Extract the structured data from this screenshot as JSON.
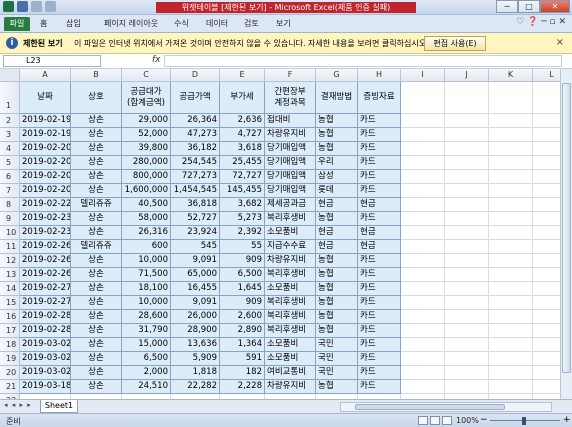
{
  "window": {
    "title": "위젯테이블 [제한된 보기] - Microsoft Excel(제품 인증 실패)",
    "min": "─",
    "max": "□",
    "close": "✕"
  },
  "ribbon": {
    "tabs": [
      "파일",
      "홈",
      "삽입",
      "페이지 레이아웃",
      "수식",
      "데이터",
      "검토",
      "보기"
    ],
    "right_icons": "♡ ❓ ─ ▫ ✕"
  },
  "protected_view": {
    "title": "제한된 보기",
    "message": "이 파일은 인터넷 위치에서 가져온 것이며 안전하지 않을 수 있습니다. 자세한 내용을 보려면 클릭하십시오.",
    "button": "편집 사용(E)",
    "close": "×"
  },
  "formula_bar": {
    "name_box": "L23",
    "fx": "fx",
    "value": ""
  },
  "columns": [
    "A",
    "B",
    "C",
    "D",
    "E",
    "F",
    "G",
    "H",
    "I",
    "J",
    "K",
    "L"
  ],
  "headers": [
    "날짜",
    "상호",
    "공급대가\n(합계금액)",
    "공급가액",
    "부가세",
    "간편장부\n계정과목",
    "결재방법",
    "증빙자료"
  ],
  "rows": [
    [
      "2019-02-19",
      "상손",
      "29,000",
      "26,364",
      "2,636",
      "접대비",
      "농협",
      "카드"
    ],
    [
      "2019-02-19",
      "상손",
      "52,000",
      "47,273",
      "4,727",
      "차량유지비",
      "농협",
      "카드"
    ],
    [
      "2019-02-20",
      "상손",
      "39,800",
      "36,182",
      "3,618",
      "당기매입액",
      "농협",
      "카드"
    ],
    [
      "2019-02-20",
      "상손",
      "280,000",
      "254,545",
      "25,455",
      "당기매입액",
      "우리",
      "카드"
    ],
    [
      "2019-02-20",
      "상손",
      "800,000",
      "727,273",
      "72,727",
      "당기매입액",
      "삼성",
      "카드"
    ],
    [
      "2019-02-20",
      "상손",
      "1,600,000",
      "1,454,545",
      "145,455",
      "당기매입액",
      "롯데",
      "카드"
    ],
    [
      "2019-02-22",
      "델리쥬쥬",
      "40,500",
      "36,818",
      "3,682",
      "제세공과금",
      "현금",
      "현금"
    ],
    [
      "2019-02-23",
      "상손",
      "58,000",
      "52,727",
      "5,273",
      "복리후생비",
      "농협",
      "카드"
    ],
    [
      "2019-02-23",
      "상손",
      "26,316",
      "23,924",
      "2,392",
      "소모품비",
      "현금",
      "현금"
    ],
    [
      "2019-02-26",
      "델리쥬쥬",
      "600",
      "545",
      "55",
      "지급수수료",
      "현금",
      "현금"
    ],
    [
      "2019-02-26",
      "상손",
      "10,000",
      "9,091",
      "909",
      "차량유지비",
      "농협",
      "카드"
    ],
    [
      "2019-02-26",
      "상손",
      "71,500",
      "65,000",
      "6,500",
      "복리후생비",
      "농협",
      "카드"
    ],
    [
      "2019-02-27",
      "상손",
      "18,100",
      "16,455",
      "1,645",
      "소모품비",
      "농협",
      "카드"
    ],
    [
      "2019-02-27",
      "상손",
      "10,000",
      "9,091",
      "909",
      "복리후생비",
      "농협",
      "카드"
    ],
    [
      "2019-02-28",
      "상손",
      "28,600",
      "26,000",
      "2,600",
      "복리후생비",
      "농협",
      "카드"
    ],
    [
      "2019-02-28",
      "상손",
      "31,790",
      "28,900",
      "2,890",
      "복리후생비",
      "농협",
      "카드"
    ],
    [
      "2019-03-02",
      "상손",
      "15,000",
      "13,636",
      "1,364",
      "소모품비",
      "국민",
      "카드"
    ],
    [
      "2019-03-02",
      "상손",
      "6,500",
      "5,909",
      "591",
      "소모품비",
      "국민",
      "카드"
    ],
    [
      "2019-03-02",
      "상손",
      "2,000",
      "1,818",
      "182",
      "여비교통비",
      "국민",
      "카드"
    ],
    [
      "2019-03-18",
      "상손",
      "24,510",
      "22,282",
      "2,228",
      "차량유지비",
      "농협",
      "카드"
    ]
  ],
  "row_numbers": [
    "1",
    "2",
    "3",
    "4",
    "5",
    "6",
    "7",
    "8",
    "9",
    "10",
    "11",
    "12",
    "13",
    "14",
    "15",
    "16",
    "17",
    "18",
    "19",
    "20",
    "21",
    "22",
    "23"
  ],
  "sheet": {
    "nav": "◂ ◂ ▸ ▸",
    "tab": "Sheet1"
  },
  "status": {
    "ready": "준비",
    "zoom": "100%",
    "zoom_out": "−",
    "zoom_in": "+"
  }
}
